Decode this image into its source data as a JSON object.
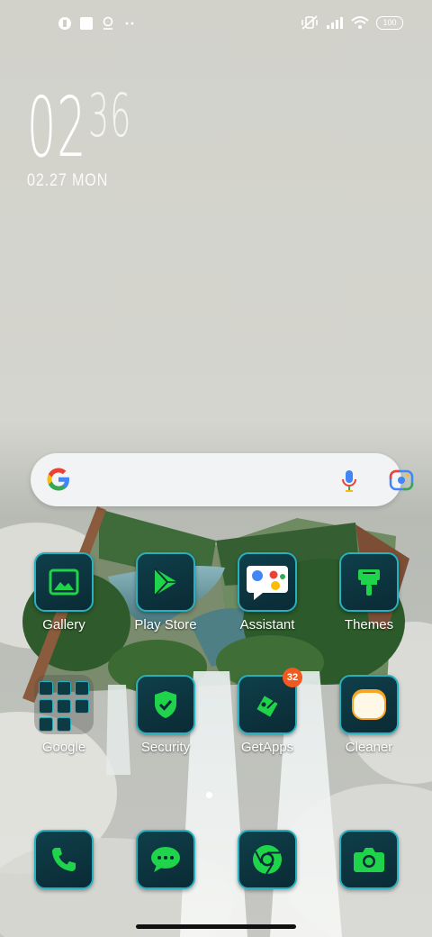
{
  "status_bar": {
    "battery": "100",
    "left_icons": [
      "notification-icon",
      "square-icon",
      "location-icon",
      "more-dots-icon"
    ],
    "right_icons": [
      "vibrate-off-icon",
      "signal-icon",
      "wifi-icon",
      "battery-icon"
    ]
  },
  "clock": {
    "hours": "02",
    "minutes": "36",
    "date": "02.27 MON"
  },
  "search": {
    "icons": [
      "google-logo",
      "mic-icon",
      "lens-icon"
    ]
  },
  "apps": [
    {
      "label": "Gallery",
      "icon": "gallery-icon"
    },
    {
      "label": "Play Store",
      "icon": "play-store-icon"
    },
    {
      "label": "Assistant",
      "icon": "assistant-icon"
    },
    {
      "label": "Themes",
      "icon": "themes-icon"
    },
    {
      "label": "Google",
      "icon": "folder-icon"
    },
    {
      "label": "Security",
      "icon": "security-icon"
    },
    {
      "label": "GetApps",
      "icon": "getapps-icon",
      "badge": "32"
    },
    {
      "label": "Cleaner",
      "icon": "cleaner-icon"
    }
  ],
  "dock": [
    {
      "icon": "phone-icon"
    },
    {
      "icon": "messages-icon"
    },
    {
      "icon": "chrome-icon"
    },
    {
      "icon": "camera-icon"
    }
  ],
  "colors": {
    "accent": "#27b0bf",
    "tile_bg": "#0f3f4a",
    "icon_green": "#1fd34a",
    "badge": "#f05a1e"
  }
}
